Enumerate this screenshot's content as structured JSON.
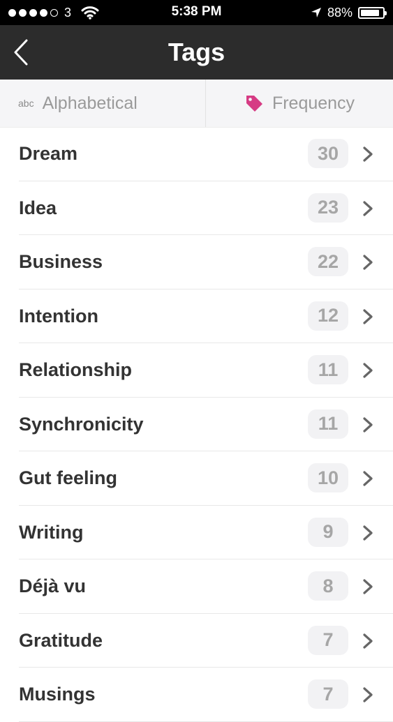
{
  "status_bar": {
    "carrier": "3",
    "time": "5:38 PM",
    "battery_percent": "88%",
    "battery_level": 0.88
  },
  "nav": {
    "title": "Tags",
    "back_icon": "chevron-left-icon"
  },
  "segments": {
    "alphabetical_prefix": "abc",
    "alphabetical_label": "Alphabetical",
    "frequency_label": "Frequency",
    "frequency_icon_color": "#d63b84"
  },
  "tags": [
    {
      "name": "Dream",
      "count": "30"
    },
    {
      "name": "Idea",
      "count": "23"
    },
    {
      "name": "Business",
      "count": "22"
    },
    {
      "name": "Intention",
      "count": "12"
    },
    {
      "name": "Relationship",
      "count": "11"
    },
    {
      "name": "Synchronicity",
      "count": "11"
    },
    {
      "name": "Gut feeling",
      "count": "10"
    },
    {
      "name": "Writing",
      "count": "9"
    },
    {
      "name": "Déjà vu",
      "count": "8"
    },
    {
      "name": "Gratitude",
      "count": "7"
    },
    {
      "name": "Musings",
      "count": "7"
    }
  ]
}
